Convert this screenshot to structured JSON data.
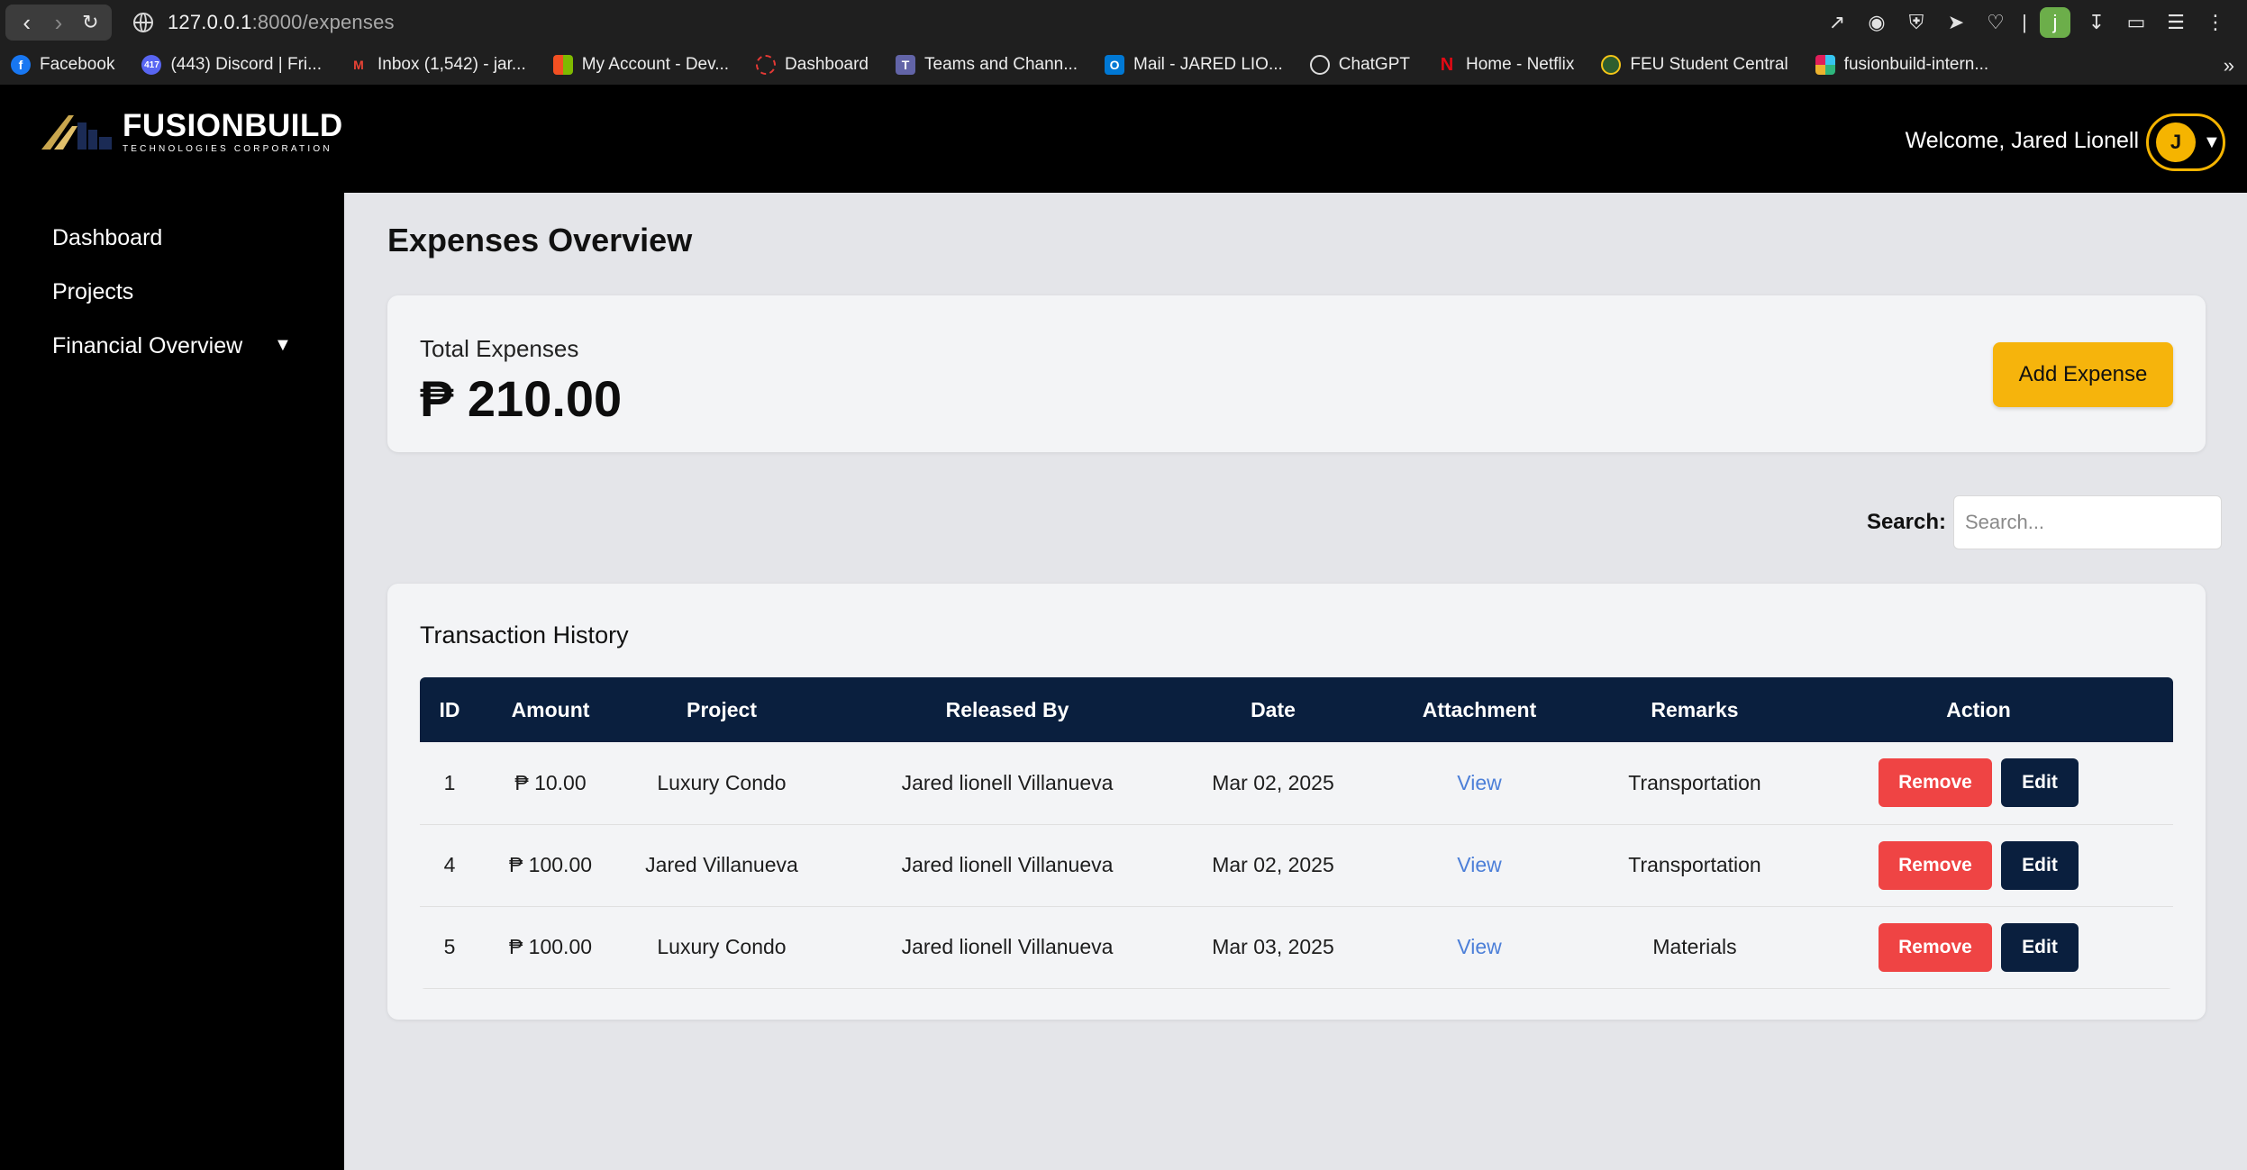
{
  "browser": {
    "url_host": "127.0.0.1",
    "url_path": ":8000/expenses",
    "profile_initial": "j",
    "bookmarks": [
      {
        "label": "Facebook",
        "icon": "facebook-icon",
        "color": "#1877f2"
      },
      {
        "label": "(443) Discord | Fri...",
        "icon": "discord-icon",
        "color": "#5865f2"
      },
      {
        "label": "Inbox (1,542) - jar...",
        "icon": "gmail-icon",
        "color": "#ea4335"
      },
      {
        "label": "My Account - Dev...",
        "icon": "microsoft-icon",
        "color": "#f25022"
      },
      {
        "label": "Dashboard",
        "icon": "dashboard-icon",
        "color": "#e53935"
      },
      {
        "label": "Teams and Chann...",
        "icon": "teams-icon",
        "color": "#6264a7"
      },
      {
        "label": "Mail - JARED LIO...",
        "icon": "outlook-icon",
        "color": "#0078d4"
      },
      {
        "label": "ChatGPT",
        "icon": "chatgpt-icon",
        "color": "#ffffff"
      },
      {
        "label": "Home - Netflix",
        "icon": "netflix-icon",
        "color": "#e50914"
      },
      {
        "label": "FEU Student Central",
        "icon": "feu-icon",
        "color": "#f5c518"
      },
      {
        "label": "fusionbuild-intern...",
        "icon": "slack-icon",
        "color": "#e01e5a"
      }
    ]
  },
  "header": {
    "logo_main": "FUSIONBUILD",
    "logo_sub": "TECHNOLOGIES CORPORATION",
    "welcome": "Welcome, Jared Lionell",
    "avatar_initial": "J",
    "accent": "#f5b400"
  },
  "sidebar": {
    "items": [
      {
        "label": "Dashboard"
      },
      {
        "label": "Projects"
      },
      {
        "label": "Financial Overview"
      }
    ]
  },
  "main": {
    "title": "Expenses Overview",
    "total_label": "Total Expenses",
    "total_value": "₱ 210.00",
    "add_button": "Add Expense",
    "search_label": "Search:",
    "search_placeholder": "Search...",
    "search_value": ""
  },
  "transactions": {
    "title": "Transaction History",
    "columns": [
      "ID",
      "Amount",
      "Project",
      "Released By",
      "Date",
      "Attachment",
      "Remarks",
      "Action"
    ],
    "rows": [
      {
        "id": "1",
        "amount": "₱ 10.00",
        "project": "Luxury Condo",
        "released_by": "Jared lionell Villanueva",
        "date": "Mar 02, 2025",
        "attachment": "View",
        "remarks": "Transportation"
      },
      {
        "id": "4",
        "amount": "₱ 100.00",
        "project": "Jared Villanueva",
        "released_by": "Jared lionell Villanueva",
        "date": "Mar 02, 2025",
        "attachment": "View",
        "remarks": "Transportation"
      },
      {
        "id": "5",
        "amount": "₱ 100.00",
        "project": "Luxury Condo",
        "released_by": "Jared lionell Villanueva",
        "date": "Mar 03, 2025",
        "attachment": "View",
        "remarks": "Materials"
      }
    ],
    "remove_label": "Remove",
    "edit_label": "Edit"
  },
  "colors": {
    "table_header": "#0a1f3e",
    "remove": "#ef4444",
    "link": "#4c7fd8",
    "add_button": "#f6b40c"
  }
}
